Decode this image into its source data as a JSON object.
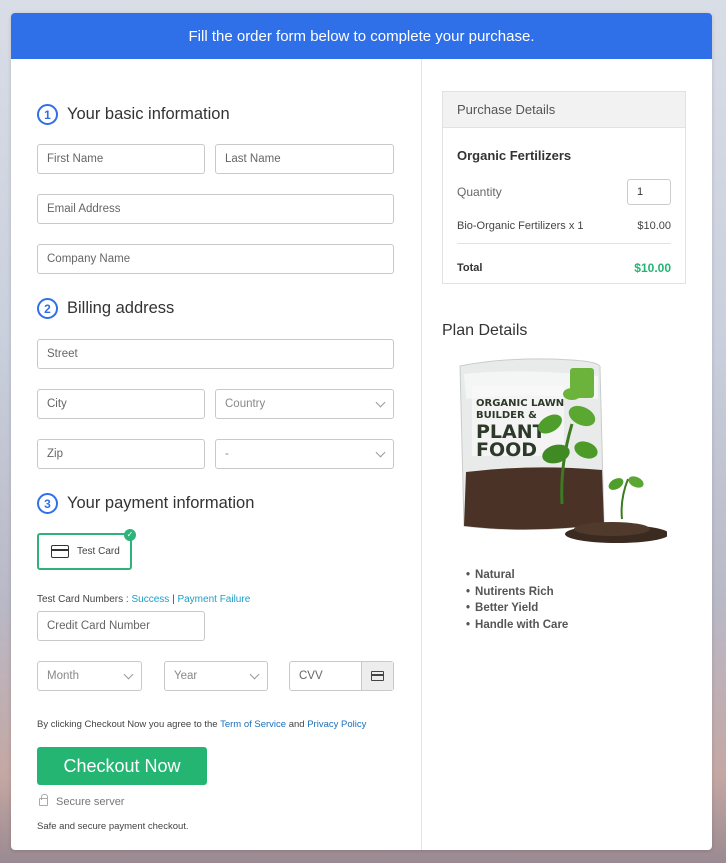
{
  "banner": {
    "text": "Fill the order form below to complete your purchase."
  },
  "basic_info": {
    "step": "1",
    "title": "Your basic information",
    "first_name_placeholder": "First Name",
    "last_name_placeholder": "Last Name",
    "email_placeholder": "Email Address",
    "company_placeholder": "Company Name"
  },
  "billing": {
    "step": "2",
    "title": "Billing address",
    "street_placeholder": "Street",
    "city_placeholder": "City",
    "country_selected": "Country",
    "zip_placeholder": "Zip",
    "state_selected": "-"
  },
  "payment": {
    "step": "3",
    "title": "Your payment information",
    "test_card_label": "Test Card",
    "test_numbers_label": "Test Card Numbers :",
    "success_link": "Success",
    "separator": "|",
    "failure_link": "Payment Failure",
    "card_number_placeholder": "Credit Card Number",
    "month_selected": "Month",
    "year_selected": "Year",
    "cvv_placeholder": "CVV"
  },
  "agreement": {
    "prefix": "By clicking Checkout Now you agree to the",
    "tos_link": "Term of Service",
    "and": "and",
    "privacy_link": "Privacy Policy"
  },
  "checkout_button": "Checkout Now",
  "secure_label": "Secure server",
  "secure_note": "Safe and secure payment checkout.",
  "purchase": {
    "header": "Purchase Details",
    "product_name": "Organic Fertilizers",
    "quantity_label": "Quantity",
    "quantity_value": "1",
    "line_item": "Bio-Organic Fertilizers x 1",
    "line_price": "$10.00",
    "total_label": "Total",
    "total_value": "$10.00"
  },
  "plan": {
    "title": "Plan Details",
    "features": [
      "Natural",
      "Nutirents Rich",
      "Better Yield",
      "Handle with Care"
    ]
  },
  "product_image": {
    "line1": "ORGANIC LAWN",
    "line2": "BUILDER &",
    "line3": "PLANT",
    "line4": "FOOD"
  },
  "colors": {
    "banner": "#2f6fe8",
    "step": "#2f6fe8",
    "checkout": "#24b573",
    "total": "#24b573",
    "link": "#1a9fc7"
  },
  "icons": [
    "card-icon",
    "check-icon",
    "chevron-down-icon",
    "lock-icon"
  ]
}
